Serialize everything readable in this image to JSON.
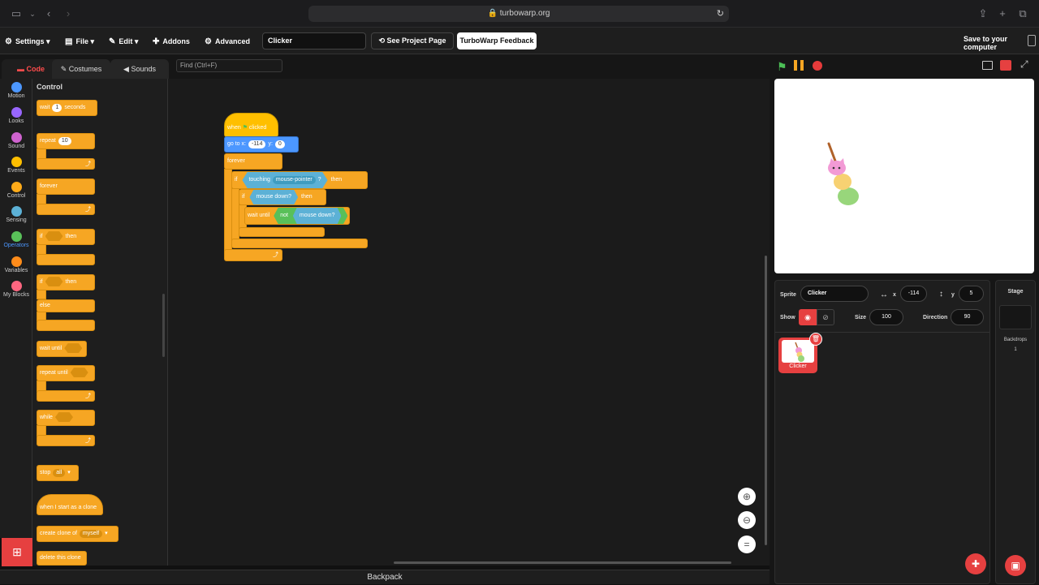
{
  "browser": {
    "url": "turbowarp.org"
  },
  "menu": {
    "settings": "Settings",
    "file": "File",
    "edit": "Edit",
    "addons": "Addons",
    "advanced": "Advanced",
    "project_title": "Clicker",
    "see_project": "See Project Page",
    "feedback": "TurboWarp Feedback",
    "save": "Save to your computer"
  },
  "tabs": {
    "code": "Code",
    "costumes": "Costumes",
    "sounds": "Sounds",
    "find_placeholder": "Find (Ctrl+F)"
  },
  "categories": [
    {
      "label": "Motion",
      "color": "#4c97ff"
    },
    {
      "label": "Looks",
      "color": "#9966ff"
    },
    {
      "label": "Sound",
      "color": "#cf63cf"
    },
    {
      "label": "Events",
      "color": "#ffbf00"
    },
    {
      "label": "Control",
      "color": "#ffab19"
    },
    {
      "label": "Sensing",
      "color": "#5cb1d6"
    },
    {
      "label": "Operators",
      "color": "#59c059"
    },
    {
      "label": "Variables",
      "color": "#ff8c1a"
    },
    {
      "label": "My Blocks",
      "color": "#ff6680"
    }
  ],
  "palette": {
    "title": "Control",
    "wait": "wait",
    "wait_val": "1",
    "seconds": "seconds",
    "repeat": "repeat",
    "repeat_val": "10",
    "forever": "forever",
    "if": "if",
    "then": "then",
    "else": "else",
    "wait_until": "wait until",
    "repeat_until": "repeat until",
    "while": "while",
    "stop": "stop",
    "stop_val": "all",
    "clone_start": "when I start as a clone",
    "create_clone": "create clone of",
    "create_clone_val": "myself",
    "delete_clone": "delete this clone"
  },
  "script": {
    "when_flag": "when",
    "clicked": "clicked",
    "goto": "go to x:",
    "x": "-114",
    "y_label": "y:",
    "y": "0",
    "forever": "forever",
    "if": "if",
    "touching": "touching",
    "touch_target": "mouse-pointer",
    "q": "?",
    "then": "then",
    "mouse_down": "mouse down?",
    "wait_until": "wait until",
    "not": "not"
  },
  "backpack": "Backpack",
  "sprite": {
    "sprite_label": "Sprite",
    "name": "Clicker",
    "x_label": "x",
    "x": "-114",
    "y_label": "y",
    "y": "5",
    "show_label": "Show",
    "size_label": "Size",
    "size": "100",
    "direction_label": "Direction",
    "direction": "90",
    "thumb_name": "Clicker"
  },
  "stage": {
    "label": "Stage",
    "backdrops_label": "Backdrops",
    "backdrops_count": "1"
  }
}
